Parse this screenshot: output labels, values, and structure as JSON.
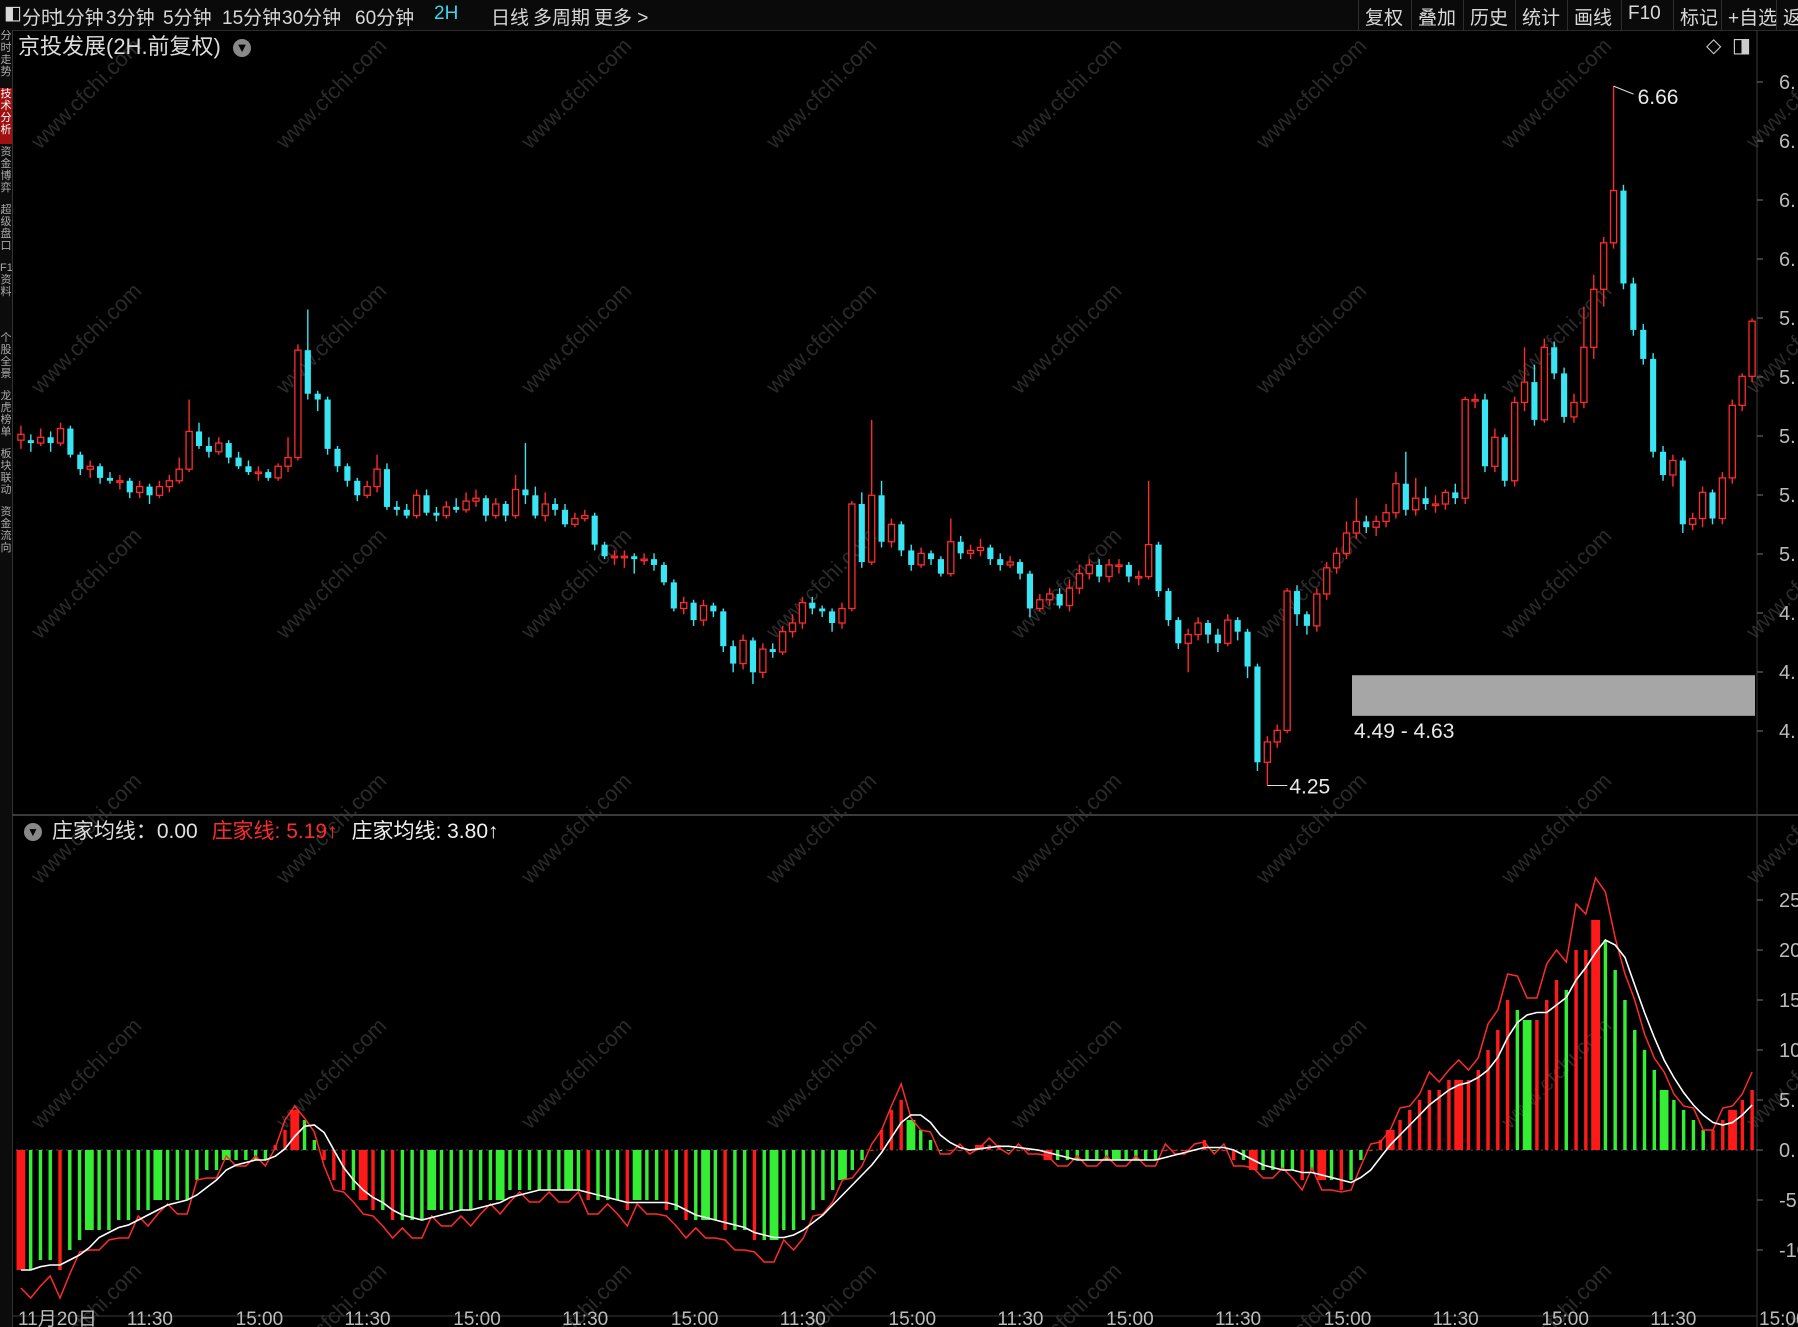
{
  "toolbar": {
    "periods": [
      "分时",
      "1分钟",
      "3分钟",
      "5分钟",
      "15分钟",
      "30分钟",
      "60分钟",
      "2H",
      "日线",
      "多周期",
      "更多 >"
    ],
    "active_period": "2H",
    "right_items": [
      "复权",
      "叠加",
      "历史",
      "统计",
      "画线",
      "F10",
      "标记",
      "+自选",
      "返"
    ]
  },
  "stock_title": "京投发展(2H.前复权)",
  "left_tabs": [
    "分时走势",
    "技术分析",
    "资金博弈",
    "超级盘口",
    "F10资料",
    "个股全景",
    "龙虎榜单",
    "板块联动",
    "资金流向"
  ],
  "main_chart": {
    "high_label": "6.66",
    "low_label": "4.25",
    "zone_label": "4.49 - 4.63",
    "price_axis_labels": [
      "6.",
      "6.",
      "6.",
      "6.",
      "5.",
      "5.",
      "5.",
      "5.",
      "5.",
      "4.",
      "4.",
      "4."
    ]
  },
  "indicator": {
    "legend_main": "庄家均线：0.00",
    "legend_red": "庄家线: 5.19↑",
    "legend_white": "庄家均线: 3.80↑",
    "axis_labels": [
      "25.",
      "20.",
      "15.",
      "10.",
      "5.",
      "0.",
      "-5.",
      "-10."
    ]
  },
  "time_axis": [
    "11月20日",
    "11:30",
    "15:00",
    "11:30",
    "15:00",
    "11:30",
    "15:00",
    "11:30",
    "15:00",
    "11:30",
    "15:00",
    "11:30",
    "15:00",
    "11:30",
    "15:00",
    "11:30",
    "15:00"
  ],
  "watermark": "www.cfchi.com",
  "colors": {
    "up": "#ff2b2b",
    "down": "#39e5f3",
    "bar_up": "#ff1a1a",
    "bar_down": "#33ee33",
    "zone": "#a6a6a6",
    "accent": "#3ad6ea"
  },
  "chart_data": [
    {
      "type": "candlestick",
      "title": "京投发展(2H.前复权)",
      "ylim": [
        4.2,
        6.75
      ],
      "candles": [
        [
          5.44,
          5.46,
          5.41,
          5.49
        ],
        [
          5.44,
          5.43,
          5.4,
          5.46
        ],
        [
          5.43,
          5.45,
          5.42,
          5.48
        ],
        [
          5.45,
          5.43,
          5.4,
          5.47
        ],
        [
          5.43,
          5.48,
          5.42,
          5.5
        ],
        [
          5.48,
          5.39,
          5.38,
          5.49
        ],
        [
          5.39,
          5.34,
          5.32,
          5.4
        ],
        [
          5.34,
          5.35,
          5.31,
          5.37
        ],
        [
          5.35,
          5.31,
          5.29,
          5.36
        ],
        [
          5.31,
          5.3,
          5.29,
          5.33
        ],
        [
          5.3,
          5.3,
          5.27,
          5.32
        ],
        [
          5.3,
          5.26,
          5.24,
          5.31
        ],
        [
          5.26,
          5.28,
          5.24,
          5.3
        ],
        [
          5.28,
          5.25,
          5.22,
          5.29
        ],
        [
          5.25,
          5.28,
          5.24,
          5.3
        ],
        [
          5.28,
          5.3,
          5.26,
          5.32
        ],
        [
          5.3,
          5.34,
          5.29,
          5.38
        ],
        [
          5.34,
          5.47,
          5.33,
          5.58
        ],
        [
          5.47,
          5.42,
          5.41,
          5.5
        ],
        [
          5.42,
          5.4,
          5.38,
          5.45
        ],
        [
          5.4,
          5.43,
          5.39,
          5.45
        ],
        [
          5.43,
          5.38,
          5.36,
          5.44
        ],
        [
          5.38,
          5.35,
          5.34,
          5.4
        ],
        [
          5.35,
          5.33,
          5.32,
          5.37
        ],
        [
          5.33,
          5.33,
          5.3,
          5.35
        ],
        [
          5.33,
          5.31,
          5.3,
          5.34
        ],
        [
          5.31,
          5.35,
          5.3,
          5.36
        ],
        [
          5.35,
          5.38,
          5.33,
          5.45
        ],
        [
          5.38,
          5.75,
          5.37,
          5.77
        ],
        [
          5.75,
          5.6,
          5.58,
          5.89
        ],
        [
          5.6,
          5.58,
          5.54,
          5.61
        ],
        [
          5.58,
          5.41,
          5.39,
          5.59
        ],
        [
          5.41,
          5.35,
          5.33,
          5.42
        ],
        [
          5.35,
          5.3,
          5.28,
          5.36
        ],
        [
          5.3,
          5.25,
          5.23,
          5.31
        ],
        [
          5.25,
          5.28,
          5.24,
          5.3
        ],
        [
          5.28,
          5.34,
          5.26,
          5.39
        ],
        [
          5.34,
          5.21,
          5.2,
          5.36
        ],
        [
          5.21,
          5.2,
          5.18,
          5.23
        ],
        [
          5.2,
          5.18,
          5.17,
          5.22
        ],
        [
          5.18,
          5.25,
          5.17,
          5.27
        ],
        [
          5.25,
          5.19,
          5.18,
          5.27
        ],
        [
          5.19,
          5.18,
          5.16,
          5.21
        ],
        [
          5.18,
          5.21,
          5.17,
          5.23
        ],
        [
          5.21,
          5.2,
          5.19,
          5.24
        ],
        [
          5.2,
          5.23,
          5.19,
          5.26
        ],
        [
          5.23,
          5.24,
          5.21,
          5.27
        ],
        [
          5.24,
          5.18,
          5.16,
          5.25
        ],
        [
          5.18,
          5.22,
          5.17,
          5.24
        ],
        [
          5.22,
          5.18,
          5.16,
          5.23
        ],
        [
          5.18,
          5.27,
          5.17,
          5.32
        ],
        [
          5.27,
          5.25,
          5.22,
          5.43
        ],
        [
          5.25,
          5.18,
          5.17,
          5.28
        ],
        [
          5.18,
          5.22,
          5.16,
          5.26
        ],
        [
          5.22,
          5.2,
          5.18,
          5.24
        ],
        [
          5.2,
          5.15,
          5.14,
          5.22
        ],
        [
          5.15,
          5.17,
          5.14,
          5.19
        ],
        [
          5.17,
          5.18,
          5.16,
          5.2
        ],
        [
          5.18,
          5.08,
          5.06,
          5.19
        ],
        [
          5.08,
          5.04,
          5.03,
          5.09
        ],
        [
          5.04,
          5.04,
          5.01,
          5.06
        ],
        [
          5.04,
          5.04,
          5.0,
          5.06
        ],
        [
          5.04,
          5.03,
          4.98,
          5.05
        ],
        [
          5.03,
          5.03,
          5.01,
          5.05
        ],
        [
          5.03,
          5.01,
          4.99,
          5.05
        ],
        [
          5.01,
          4.95,
          4.94,
          5.02
        ],
        [
          4.95,
          4.86,
          4.85,
          4.96
        ],
        [
          4.86,
          4.88,
          4.84,
          4.9
        ],
        [
          4.88,
          4.82,
          4.8,
          4.89
        ],
        [
          4.82,
          4.87,
          4.8,
          4.89
        ],
        [
          4.87,
          4.85,
          4.83,
          4.88
        ],
        [
          4.85,
          4.73,
          4.71,
          4.86
        ],
        [
          4.73,
          4.67,
          4.64,
          4.75
        ],
        [
          4.67,
          4.75,
          4.65,
          4.77
        ],
        [
          4.75,
          4.64,
          4.6,
          4.76
        ],
        [
          4.64,
          4.72,
          4.62,
          4.74
        ],
        [
          4.72,
          4.71,
          4.69,
          4.74
        ],
        [
          4.71,
          4.78,
          4.7,
          4.8
        ],
        [
          4.78,
          4.81,
          4.76,
          4.84
        ],
        [
          4.81,
          4.88,
          4.79,
          4.9
        ],
        [
          4.88,
          4.86,
          4.84,
          4.9
        ],
        [
          4.86,
          4.85,
          4.83,
          4.87
        ],
        [
          4.85,
          4.81,
          4.78,
          4.86
        ],
        [
          4.81,
          4.86,
          4.79,
          4.88
        ],
        [
          4.86,
          5.22,
          4.85,
          5.23
        ],
        [
          5.22,
          5.02,
          5.0,
          5.26
        ],
        [
          5.02,
          5.25,
          5.01,
          5.51
        ],
        [
          5.25,
          5.09,
          5.07,
          5.3
        ],
        [
          5.09,
          5.15,
          5.07,
          5.17
        ],
        [
          5.15,
          5.06,
          5.04,
          5.16
        ],
        [
          5.06,
          5.01,
          4.99,
          5.08
        ],
        [
          5.01,
          5.05,
          5.0,
          5.07
        ],
        [
          5.05,
          5.03,
          5.01,
          5.06
        ],
        [
          5.03,
          4.98,
          4.97,
          5.04
        ],
        [
          4.98,
          5.09,
          4.97,
          5.17
        ],
        [
          5.09,
          5.05,
          5.03,
          5.11
        ],
        [
          5.05,
          5.06,
          5.03,
          5.08
        ],
        [
          5.06,
          5.07,
          5.04,
          5.1
        ],
        [
          5.07,
          5.03,
          5.01,
          5.08
        ],
        [
          5.03,
          5.01,
          4.99,
          5.05
        ],
        [
          5.01,
          5.02,
          5.0,
          5.04
        ],
        [
          5.02,
          4.98,
          4.96,
          5.03
        ],
        [
          4.98,
          4.86,
          4.83,
          4.99
        ],
        [
          4.86,
          4.89,
          4.85,
          4.91
        ],
        [
          4.89,
          4.91,
          4.87,
          4.93
        ],
        [
          4.91,
          4.87,
          4.86,
          4.93
        ],
        [
          4.87,
          4.93,
          4.85,
          4.96
        ],
        [
          4.93,
          4.98,
          4.91,
          5.01
        ],
        [
          4.98,
          5.01,
          4.96,
          5.03
        ],
        [
          5.01,
          4.97,
          4.95,
          5.03
        ],
        [
          4.97,
          5.01,
          4.95,
          5.03
        ],
        [
          5.01,
          5.01,
          4.98,
          5.03
        ],
        [
          5.01,
          4.97,
          4.95,
          5.02
        ],
        [
          4.97,
          4.97,
          4.94,
          4.99
        ],
        [
          4.97,
          5.08,
          4.96,
          5.3
        ],
        [
          5.08,
          4.92,
          4.9,
          5.09
        ],
        [
          4.92,
          4.82,
          4.8,
          4.93
        ],
        [
          4.82,
          4.74,
          4.72,
          4.83
        ],
        [
          4.74,
          4.77,
          4.64,
          4.79
        ],
        [
          4.77,
          4.81,
          4.75,
          4.83
        ],
        [
          4.81,
          4.77,
          4.74,
          4.82
        ],
        [
          4.77,
          4.74,
          4.71,
          4.79
        ],
        [
          4.74,
          4.82,
          4.73,
          4.84
        ],
        [
          4.82,
          4.78,
          4.75,
          4.83
        ],
        [
          4.78,
          4.66,
          4.62,
          4.79
        ],
        [
          4.66,
          4.33,
          4.3,
          4.67
        ],
        [
          4.33,
          4.4,
          4.25,
          4.42
        ],
        [
          4.4,
          4.44,
          4.38,
          4.46
        ],
        [
          4.44,
          4.92,
          4.43,
          4.93
        ],
        [
          4.92,
          4.84,
          4.8,
          4.94
        ],
        [
          4.84,
          4.8,
          4.77,
          4.85
        ],
        [
          4.8,
          4.91,
          4.78,
          4.93
        ],
        [
          4.91,
          5.0,
          4.89,
          5.02
        ],
        [
          5.0,
          5.05,
          4.98,
          5.07
        ],
        [
          5.05,
          5.12,
          5.03,
          5.16
        ],
        [
          5.12,
          5.16,
          5.1,
          5.24
        ],
        [
          5.16,
          5.14,
          5.12,
          5.18
        ],
        [
          5.14,
          5.16,
          5.11,
          5.18
        ],
        [
          5.16,
          5.19,
          5.14,
          5.22
        ],
        [
          5.19,
          5.29,
          5.17,
          5.33
        ],
        [
          5.29,
          5.2,
          5.18,
          5.4
        ],
        [
          5.2,
          5.24,
          5.18,
          5.31
        ],
        [
          5.24,
          5.22,
          5.2,
          5.28
        ],
        [
          5.22,
          5.22,
          5.19,
          5.25
        ],
        [
          5.22,
          5.26,
          5.2,
          5.27
        ],
        [
          5.26,
          5.24,
          5.22,
          5.29
        ],
        [
          5.24,
          5.58,
          5.22,
          5.59
        ],
        [
          5.58,
          5.58,
          5.55,
          5.6
        ],
        [
          5.58,
          5.35,
          5.33,
          5.6
        ],
        [
          5.35,
          5.45,
          5.33,
          5.48
        ],
        [
          5.45,
          5.3,
          5.28,
          5.46
        ],
        [
          5.3,
          5.57,
          5.28,
          5.59
        ],
        [
          5.57,
          5.64,
          5.54,
          5.76
        ],
        [
          5.64,
          5.51,
          5.49,
          5.7
        ],
        [
          5.51,
          5.76,
          5.5,
          5.79
        ],
        [
          5.76,
          5.67,
          5.65,
          5.78
        ],
        [
          5.67,
          5.52,
          5.5,
          5.69
        ],
        [
          5.52,
          5.57,
          5.5,
          5.6
        ],
        [
          5.57,
          5.76,
          5.55,
          5.9
        ],
        [
          5.76,
          5.96,
          5.72,
          6.01
        ],
        [
          5.96,
          6.12,
          5.9,
          6.14
        ],
        [
          6.12,
          6.3,
          6.1,
          6.66
        ],
        [
          6.3,
          5.98,
          5.96,
          6.32
        ],
        [
          5.98,
          5.82,
          5.8,
          6.0
        ],
        [
          5.82,
          5.72,
          5.7,
          5.84
        ],
        [
          5.72,
          5.4,
          5.38,
          5.74
        ],
        [
          5.4,
          5.32,
          5.3,
          5.42
        ],
        [
          5.32,
          5.37,
          5.28,
          5.39
        ],
        [
          5.37,
          5.15,
          5.12,
          5.38
        ],
        [
          5.15,
          5.17,
          5.13,
          5.19
        ],
        [
          5.17,
          5.26,
          5.14,
          5.28
        ],
        [
          5.26,
          5.17,
          5.15,
          5.27
        ],
        [
          5.17,
          5.31,
          5.15,
          5.33
        ],
        [
          5.31,
          5.56,
          5.29,
          5.58
        ],
        [
          5.56,
          5.66,
          5.54,
          5.67
        ],
        [
          5.66,
          5.85,
          5.64,
          5.86
        ]
      ]
    },
    {
      "type": "bar+line",
      "title": "庄家均线",
      "ylim": [
        -16,
        29
      ],
      "bars": [
        -12,
        -12,
        -11,
        -11,
        -12,
        -10,
        -9,
        -8,
        -8,
        -8,
        -7,
        -7,
        -6,
        -6,
        -5,
        -5,
        -5,
        -5,
        -3,
        -2,
        -2,
        -1,
        -1,
        -1,
        -1,
        -1,
        0.5,
        2,
        4,
        3,
        1,
        -1,
        -3,
        -4,
        -4,
        -5,
        -6,
        -6,
        -7,
        -7,
        -7,
        -7,
        -6,
        -6,
        -6,
        -6,
        -6,
        -5,
        -5,
        -5,
        -4,
        -4,
        -4,
        -4,
        -4,
        -4,
        -4,
        -4,
        -5,
        -5,
        -5,
        -5,
        -6,
        -5,
        -5,
        -5,
        -6,
        -6,
        -7,
        -7,
        -7,
        -7,
        -8,
        -8,
        -8,
        -9,
        -9,
        -9,
        -8,
        -8,
        -7,
        -6,
        -5,
        -4,
        -3,
        -2,
        -1,
        0,
        2,
        4,
        5,
        3,
        2,
        1,
        0,
        0,
        0,
        0,
        0.5,
        0.5,
        0.5,
        0,
        0,
        0,
        0,
        -1,
        -1,
        -1,
        -1,
        -1,
        -1,
        -1,
        -1,
        -1,
        -1,
        -1,
        -1,
        0,
        0,
        0,
        0,
        1,
        0,
        0,
        -1,
        -1,
        -2,
        -2,
        -2,
        -2,
        -2,
        -3,
        -2,
        -3,
        -3,
        -4,
        -3,
        -1,
        0,
        1,
        2,
        3,
        4,
        5,
        6,
        6,
        7,
        7,
        7,
        8,
        10,
        12,
        15,
        14,
        13,
        13,
        15,
        17,
        16,
        20,
        20,
        23,
        21,
        18,
        15,
        12,
        10,
        8,
        6,
        5,
        4,
        3,
        2,
        2,
        3,
        4,
        5,
        6
      ],
      "series": [
        {
          "name": "庄家线",
          "color": "#ff2b2b"
        },
        {
          "name": "庄家均线",
          "color": "#ffffff"
        }
      ]
    }
  ]
}
